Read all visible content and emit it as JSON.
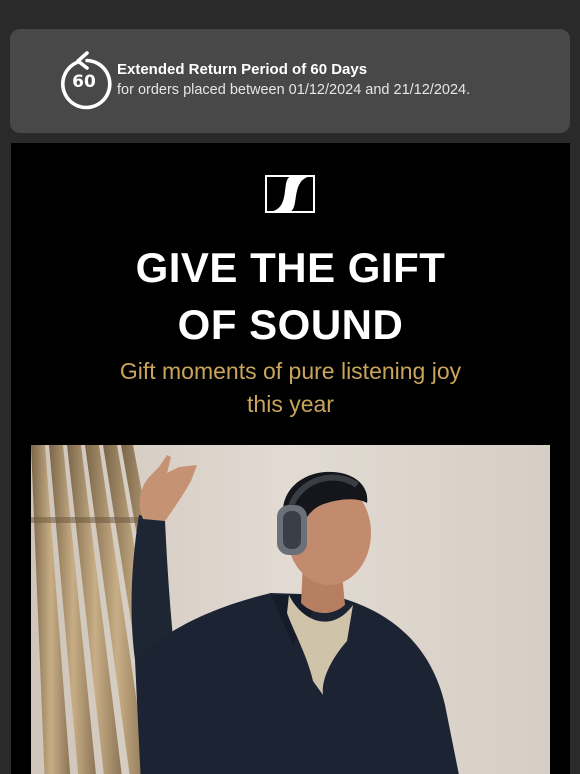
{
  "return_banner": {
    "icon": "return-arrow-circle-icon",
    "icon_number": "60",
    "title": "Extended Return Period of 60 Days",
    "description": "for orders placed between 01/12/2024 and 21/12/2024."
  },
  "hero": {
    "logo": "sennheiser-logo",
    "headline_line1": "GIVE THE GIFT",
    "headline_line2": "OF SOUND",
    "subheadline_line1": "Gift moments of pure listening joy",
    "subheadline_line2": "this year",
    "image": "man-wearing-headphones-pointing-up"
  },
  "colors": {
    "page_background": "#2a2a2a",
    "banner_background": "#484848",
    "hero_background": "#000000",
    "accent_gold": "#c9a45c"
  }
}
